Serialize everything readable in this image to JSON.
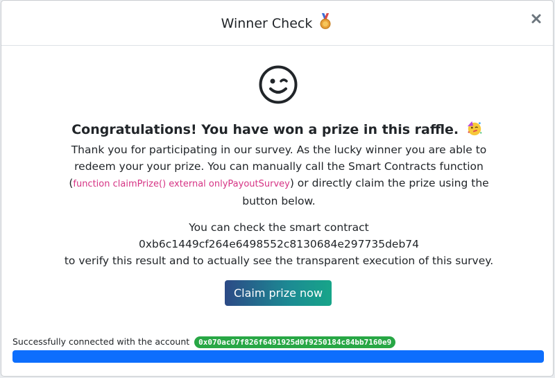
{
  "modal": {
    "title": "Winner Check",
    "title_icon": "medal-icon",
    "close_icon": "close-icon"
  },
  "content": {
    "smiley_icon": "winking-face-icon",
    "headline": "Congratulations! You have won a prize in this raffle.",
    "headline_icon": "partying-face-icon",
    "paragraph1_part1": "Thank you for participating in our survey. As the lucky winner you are able to redeem your your prize. You can manually call the Smart Contracts function (",
    "function_signature": "function claimPrize() external onlyPayoutSurvey",
    "paragraph1_part2": ") or directly claim the prize using the button below.",
    "check_text": "You can check the smart contract",
    "contract_address": "0xb6c1449cf264e6498552c8130684e297735deb74",
    "verify_text": "to verify this result and to actually see the transparent execution of this survey."
  },
  "claim_button": {
    "label": "Claim prize now"
  },
  "status": {
    "text": "Successfully connected with the account",
    "account": "0x070ac07f826f6491925d0f9250184c84bb7160e9",
    "progress_percent": 100
  },
  "colors": {
    "badge": "#28a745",
    "progress": "#0d6efd",
    "code": "#d63384",
    "button_start": "#2c4a86",
    "button_end": "#17a589"
  }
}
